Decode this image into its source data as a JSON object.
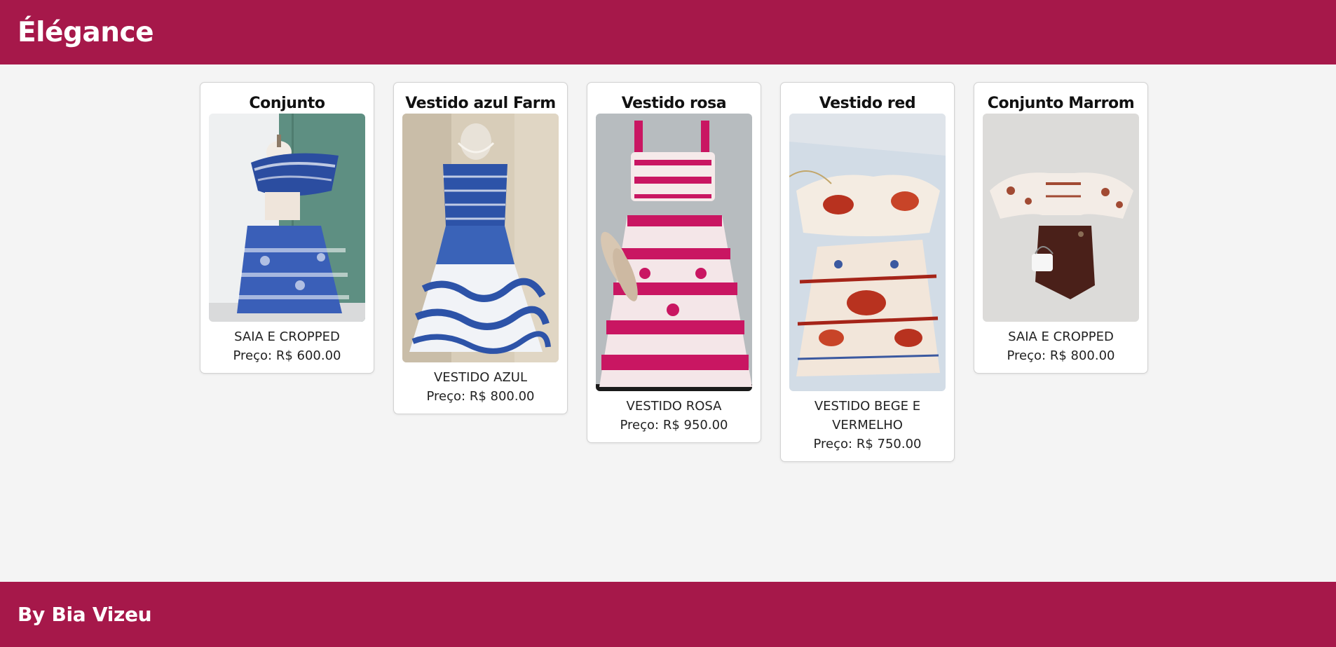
{
  "header": {
    "brand": "Élégance"
  },
  "products": [
    {
      "title": "Conjunto",
      "description": "SAIA E CROPPED",
      "price": "Preço: R$ 600.00",
      "image": "blue-skirt-cropped-photo"
    },
    {
      "title": "Vestido azul Farm",
      "description": "VESTIDO AZUL",
      "price": "Preço: R$ 800.00",
      "image": "blue-strapless-dress-photo"
    },
    {
      "title": "Vestido rosa",
      "description": "VESTIDO ROSA",
      "price": "Preço: R$ 950.00",
      "image": "pink-dress-set-photo"
    },
    {
      "title": "Vestido red",
      "description": "VESTIDO BEGE E VERMELHO",
      "price": "Preço: R$ 750.00",
      "image": "beige-red-dress-photo"
    },
    {
      "title": "Conjunto Marrom",
      "description": "SAIA E CROPPED",
      "price": "Preço: R$ 800.00",
      "image": "brown-skirt-set-photo"
    }
  ],
  "footer": {
    "text": "By Bia Vizeu"
  },
  "colors": {
    "brand": "#a6184a",
    "background": "#f4f4f4",
    "card": "#ffffff"
  }
}
